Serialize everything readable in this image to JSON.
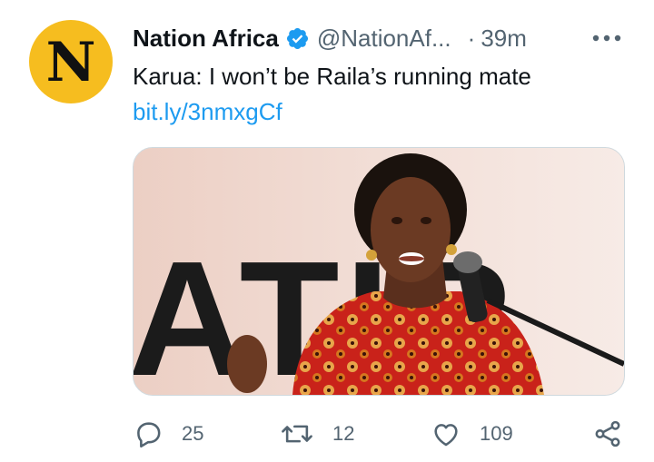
{
  "author": {
    "avatar_letter": "N",
    "display_name": "Nation Africa",
    "verified": true,
    "handle": "@NationAf...",
    "separator": "·",
    "timestamp": "39m"
  },
  "tweet": {
    "text": "Karua: I won’t be Raila’s running mate",
    "link": "bit.ly/3nmxgCf"
  },
  "media": {
    "backdrop_text": "ATIR"
  },
  "actions": {
    "replies": "25",
    "retweets": "12",
    "likes": "109"
  },
  "icons": {
    "avatar": "nation-africa-logo",
    "verified": "verified-badge-icon",
    "more": "more-options-icon",
    "reply": "reply-icon",
    "retweet": "retweet-icon",
    "like": "heart-icon",
    "share": "share-icon"
  },
  "colors": {
    "avatar_bg": "#f6bd1f",
    "link": "#1d9bf0",
    "secondary_text": "#536471",
    "primary_text": "#0f1419",
    "verified": "#1d9bf0"
  }
}
